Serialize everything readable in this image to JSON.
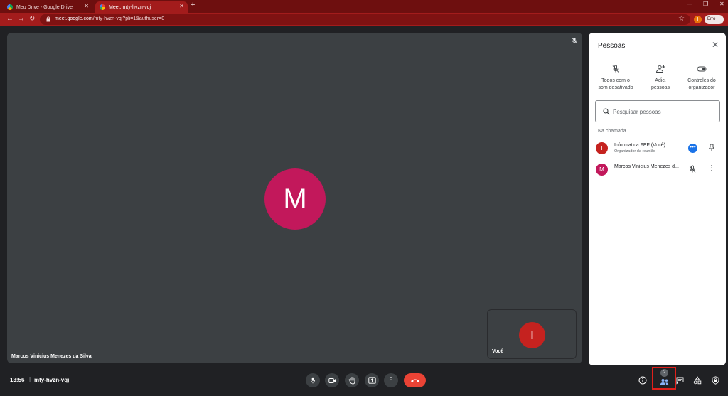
{
  "browser": {
    "tabs": [
      {
        "title": "Meu Drive - Google Drive",
        "active": false,
        "favicon": "google-drive-icon"
      },
      {
        "title": "Meet: mty-hvzn-vqj",
        "active": true,
        "favicon": "google-meet-icon"
      }
    ],
    "url_host": "meet.google.com",
    "url_path": "/mty-hvzn-vqj?pli=1&authuser=0",
    "profile_initial": "I",
    "error_label": "Erro",
    "theme_color": "#a31c1c"
  },
  "stage": {
    "speaker_initial": "M",
    "speaker_name": "Marcos Vinicius Menezes da Silva",
    "speaker_avatar_color": "#c2185b",
    "self_initial": "I",
    "self_label": "Você",
    "self_avatar_color": "#c5221f"
  },
  "people_panel": {
    "title": "Pessoas",
    "actions": [
      {
        "label_line1": "Todos com o",
        "label_line2": "som desativado",
        "icon": "mic-off-icon"
      },
      {
        "label_line1": "Adic.",
        "label_line2": "pessoas",
        "icon": "person-add-icon"
      },
      {
        "label_line1": "Controles do",
        "label_line2": "organizador",
        "icon": "toggle-icon"
      }
    ],
    "search_placeholder": "Pesquisar pessoas",
    "section_label": "Na chamada",
    "participants": [
      {
        "initial": "I",
        "name": "Informatica FEF (Você)",
        "subtitle": "Organizador da reunião",
        "color": "#c5221f"
      },
      {
        "initial": "M",
        "name": "Marcos Vinicius Menezes d...",
        "subtitle": "",
        "color": "#c2185b"
      }
    ]
  },
  "bottom_bar": {
    "time": "13:56",
    "separator": "|",
    "meeting_code": "mty-hvzn-vqj",
    "participants_count": "2",
    "hangup_color": "#ea4335"
  }
}
